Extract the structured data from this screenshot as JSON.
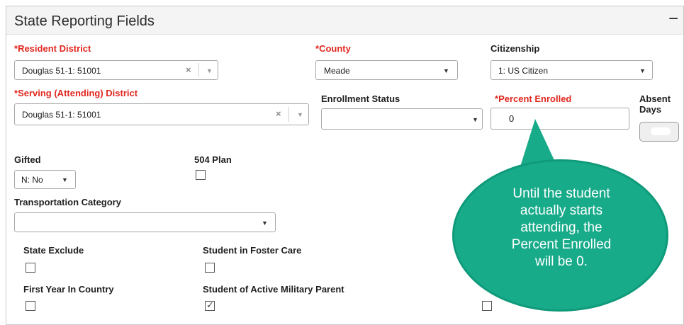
{
  "panel": {
    "title": "State Reporting Fields",
    "collapse_symbol": "−"
  },
  "resident_district": {
    "label": "Resident District",
    "value": "Douglas 51-1: 51001"
  },
  "county": {
    "label": "County",
    "value": "Meade"
  },
  "citizenship": {
    "label": "Citizenship",
    "value": "1: US Citizen"
  },
  "serving_district": {
    "label": "Serving (Attending) District",
    "value": "Douglas 51-1: 51001"
  },
  "enrollment_status": {
    "label": "Enrollment Status",
    "value": ""
  },
  "percent_enrolled": {
    "label": "Percent Enrolled",
    "value": "0"
  },
  "absent_days": {
    "label_line1": "Absent",
    "label_line2": "Days"
  },
  "gifted": {
    "label": "Gifted",
    "value": "N: No"
  },
  "plan_504": {
    "label": "504 Plan",
    "checked": false
  },
  "transportation": {
    "label": "Transportation Category",
    "value": ""
  },
  "state_exclude": {
    "label": "State Exclude",
    "checked": false
  },
  "foster_care": {
    "label": "Student in Foster Care",
    "checked": false
  },
  "first_year": {
    "label": "First Year In Country",
    "checked": false
  },
  "military_parent": {
    "label": "Student of Active Military Parent",
    "checked": true
  },
  "required_marker": "*",
  "icons": {
    "clear": "×",
    "dropdown": "▼",
    "check": "✓"
  },
  "callout": {
    "line1": "Until the student",
    "line2": "actually starts",
    "line3": "attending, the",
    "line4": "Percent Enrolled",
    "line5": "will be 0."
  },
  "colors": {
    "required": "#e0281f",
    "callout": "#18ab8a",
    "header_bg": "#f4f4f4"
  }
}
